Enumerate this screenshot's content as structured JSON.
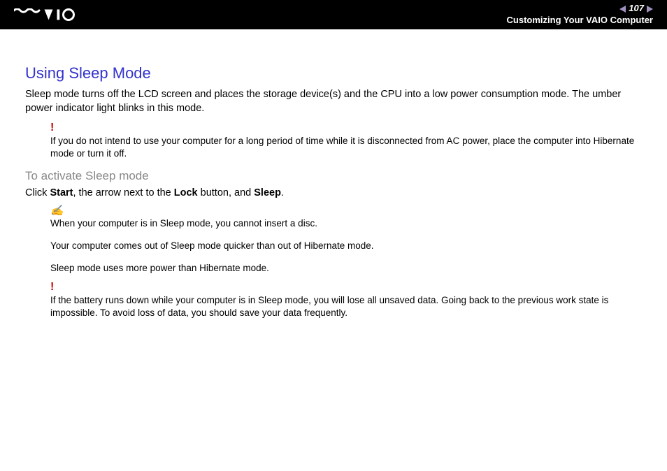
{
  "header": {
    "page_number": "107",
    "breadcrumb": "Customizing Your VAIO Computer"
  },
  "main": {
    "title": "Using Sleep Mode",
    "intro": "Sleep mode turns off the LCD screen and places the storage device(s) and the CPU into a low power consumption mode. The umber power indicator light blinks in this mode.",
    "warning1": "If you do not intend to use your computer for a long period of time while it is disconnected from AC power, place the computer into Hibernate mode or turn it off.",
    "subtitle": "To activate Sleep mode",
    "instruction_prefix": "Click ",
    "instruction_b1": "Start",
    "instruction_mid1": ", the arrow next to the ",
    "instruction_b2": "Lock",
    "instruction_mid2": " button, and ",
    "instruction_b3": "Sleep",
    "instruction_suffix": ".",
    "note_p1": "When your computer is in Sleep mode, you cannot insert a disc.",
    "note_p2": "Your computer comes out of Sleep mode quicker than out of Hibernate mode.",
    "note_p3": "Sleep mode uses more power than Hibernate mode.",
    "warning2": "If the battery runs down while your computer is in Sleep mode, you will lose all unsaved data. Going back to the previous work state is impossible. To avoid loss of data, you should save your data frequently."
  },
  "icons": {
    "warning": "!",
    "note": "✍"
  }
}
